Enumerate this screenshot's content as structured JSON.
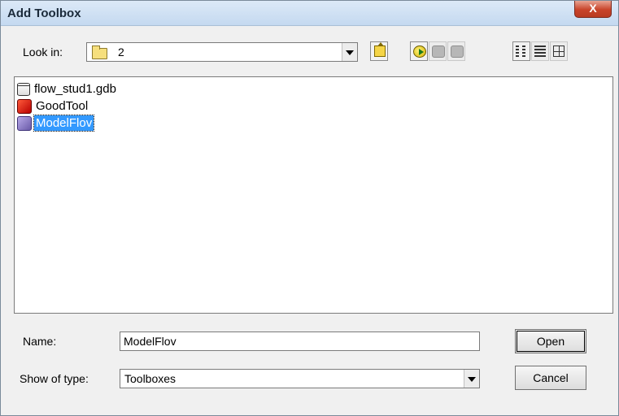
{
  "window": {
    "title": "Add Toolbox",
    "close_glyph": "X"
  },
  "lookin": {
    "label": "Look in:",
    "value": "2",
    "icon": "folder-icon"
  },
  "toolbar": {
    "buttons": [
      {
        "name": "up-one-level",
        "icon": "up-folder-icon"
      },
      {
        "name": "connect-to-folder",
        "icon": "connect-folder-icon"
      },
      {
        "name": "disconnect-folder",
        "icon": "disconnect-icon"
      },
      {
        "name": "new-item",
        "icon": "new-item-icon"
      },
      {
        "name": "list-view",
        "icon": "list-view-icon"
      },
      {
        "name": "details-view",
        "icon": "details-view-icon"
      },
      {
        "name": "thumbnails-view",
        "icon": "thumbnails-view-icon"
      }
    ]
  },
  "files": [
    {
      "label": "flow_stud1.gdb",
      "icon": "geodatabase-icon",
      "selected": false
    },
    {
      "label": "GoodTool",
      "icon": "toolbox-icon",
      "selected": false
    },
    {
      "label": "ModelFlov",
      "icon": "toolbox-icon",
      "selected": true
    }
  ],
  "name_field": {
    "label": "Name:",
    "value": "ModelFlov"
  },
  "type_field": {
    "label": "Show of type:",
    "value": "Toolboxes"
  },
  "buttons": {
    "open": "Open",
    "cancel": "Cancel"
  }
}
